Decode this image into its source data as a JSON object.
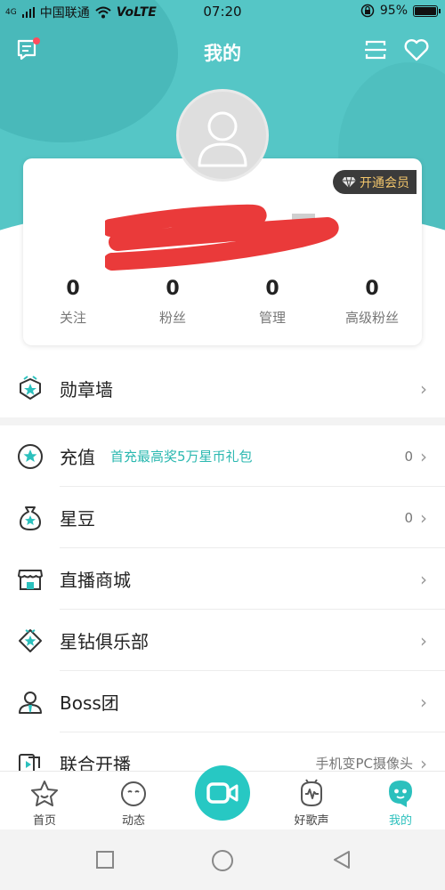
{
  "status_bar": {
    "signal_tag": "4G",
    "carrier": "中国联通",
    "network": "VoLTE",
    "time": "07:20",
    "battery": "95%",
    "battery_level": 0.95
  },
  "header": {
    "title": "我的"
  },
  "profile": {
    "vip_label": "开通会员",
    "stats": [
      {
        "value": "0",
        "label": "关注"
      },
      {
        "value": "0",
        "label": "粉丝"
      },
      {
        "value": "0",
        "label": "管理"
      },
      {
        "value": "0",
        "label": "高级粉丝"
      }
    ]
  },
  "menu": [
    {
      "label": "勋章墙",
      "icon": "medal-wall-icon"
    },
    {
      "label": "充值",
      "promo": "首充最高奖5万星币礼包",
      "value": "0",
      "icon": "star-coin-icon"
    },
    {
      "label": "星豆",
      "value": "0",
      "icon": "star-bean-bag-icon"
    },
    {
      "label": "直播商城",
      "icon": "shop-icon"
    },
    {
      "label": "星钻俱乐部",
      "icon": "star-diamond-icon"
    },
    {
      "label": "Boss团",
      "icon": "boss-group-icon"
    },
    {
      "label": "联合开播",
      "value": "手机变PC摄像头",
      "icon": "co-live-icon"
    }
  ],
  "tabs": [
    {
      "label": "首页",
      "icon": "home-star-icon"
    },
    {
      "label": "动态",
      "icon": "moments-icon"
    },
    {
      "label": "",
      "icon": "video-camera-icon"
    },
    {
      "label": "好歌声",
      "icon": "good-voice-icon"
    },
    {
      "label": "我的",
      "icon": "me-icon",
      "active": true
    }
  ],
  "colors": {
    "accent": "#2bc0bd",
    "header_bg": "#55c6c6",
    "vip_text": "#f3c66b",
    "redaction": "#ea3a3a"
  }
}
